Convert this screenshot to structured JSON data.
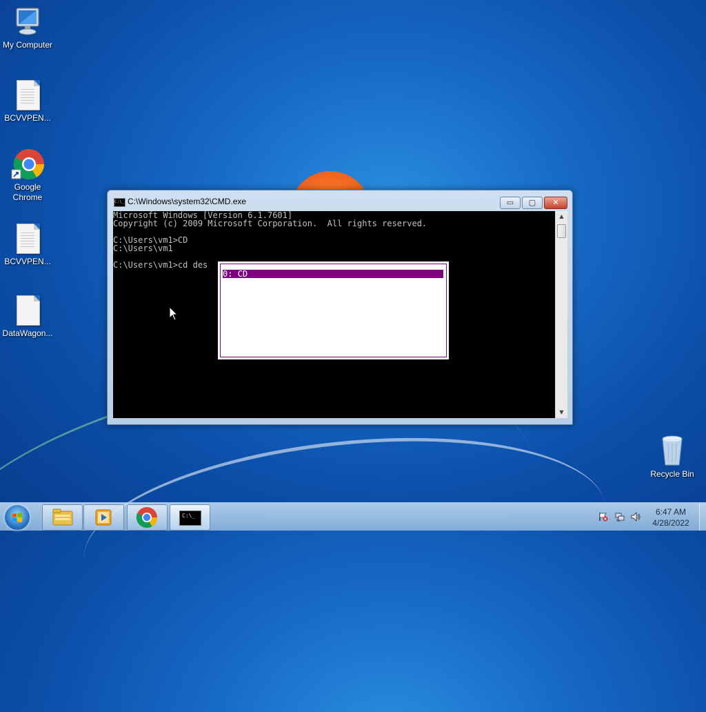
{
  "desktop": {
    "icons": [
      {
        "label": "My Computer"
      },
      {
        "label": "BCVVPEN..."
      },
      {
        "label": "Google Chrome"
      },
      {
        "label": "BCVVPEN..."
      },
      {
        "label": "DataWagon..."
      },
      {
        "label": "Recycle Bin"
      }
    ]
  },
  "window": {
    "title": "C:\\Windows\\system32\\CMD.exe",
    "icon_text": "C:\\_",
    "console_lines": [
      "Microsoft Windows [Version 6.1.7601]",
      "Copyright (c) 2009 Microsoft Corporation.  All rights reserved.",
      "",
      "C:\\Users\\vm1>CD",
      "C:\\Users\\vm1",
      "",
      "C:\\Users\\vm1>cd des"
    ],
    "history_popup": {
      "items": [
        "0: CD"
      ]
    },
    "buttons": {
      "minimize": "▭",
      "maximize": "▢",
      "close": "✕"
    }
  },
  "taskbar": {
    "buttons": [
      "windows-explorer",
      "media-player",
      "google-chrome",
      "command-prompt"
    ],
    "cmd_icon_text": "C:\\_",
    "clock": {
      "time": "6:47 AM",
      "date": "4/28/2022"
    }
  },
  "colors": {
    "popup_accent": "#800080",
    "console_bg": "#000000",
    "console_fg": "#c0c0c0",
    "close_button": "#c4442a"
  }
}
